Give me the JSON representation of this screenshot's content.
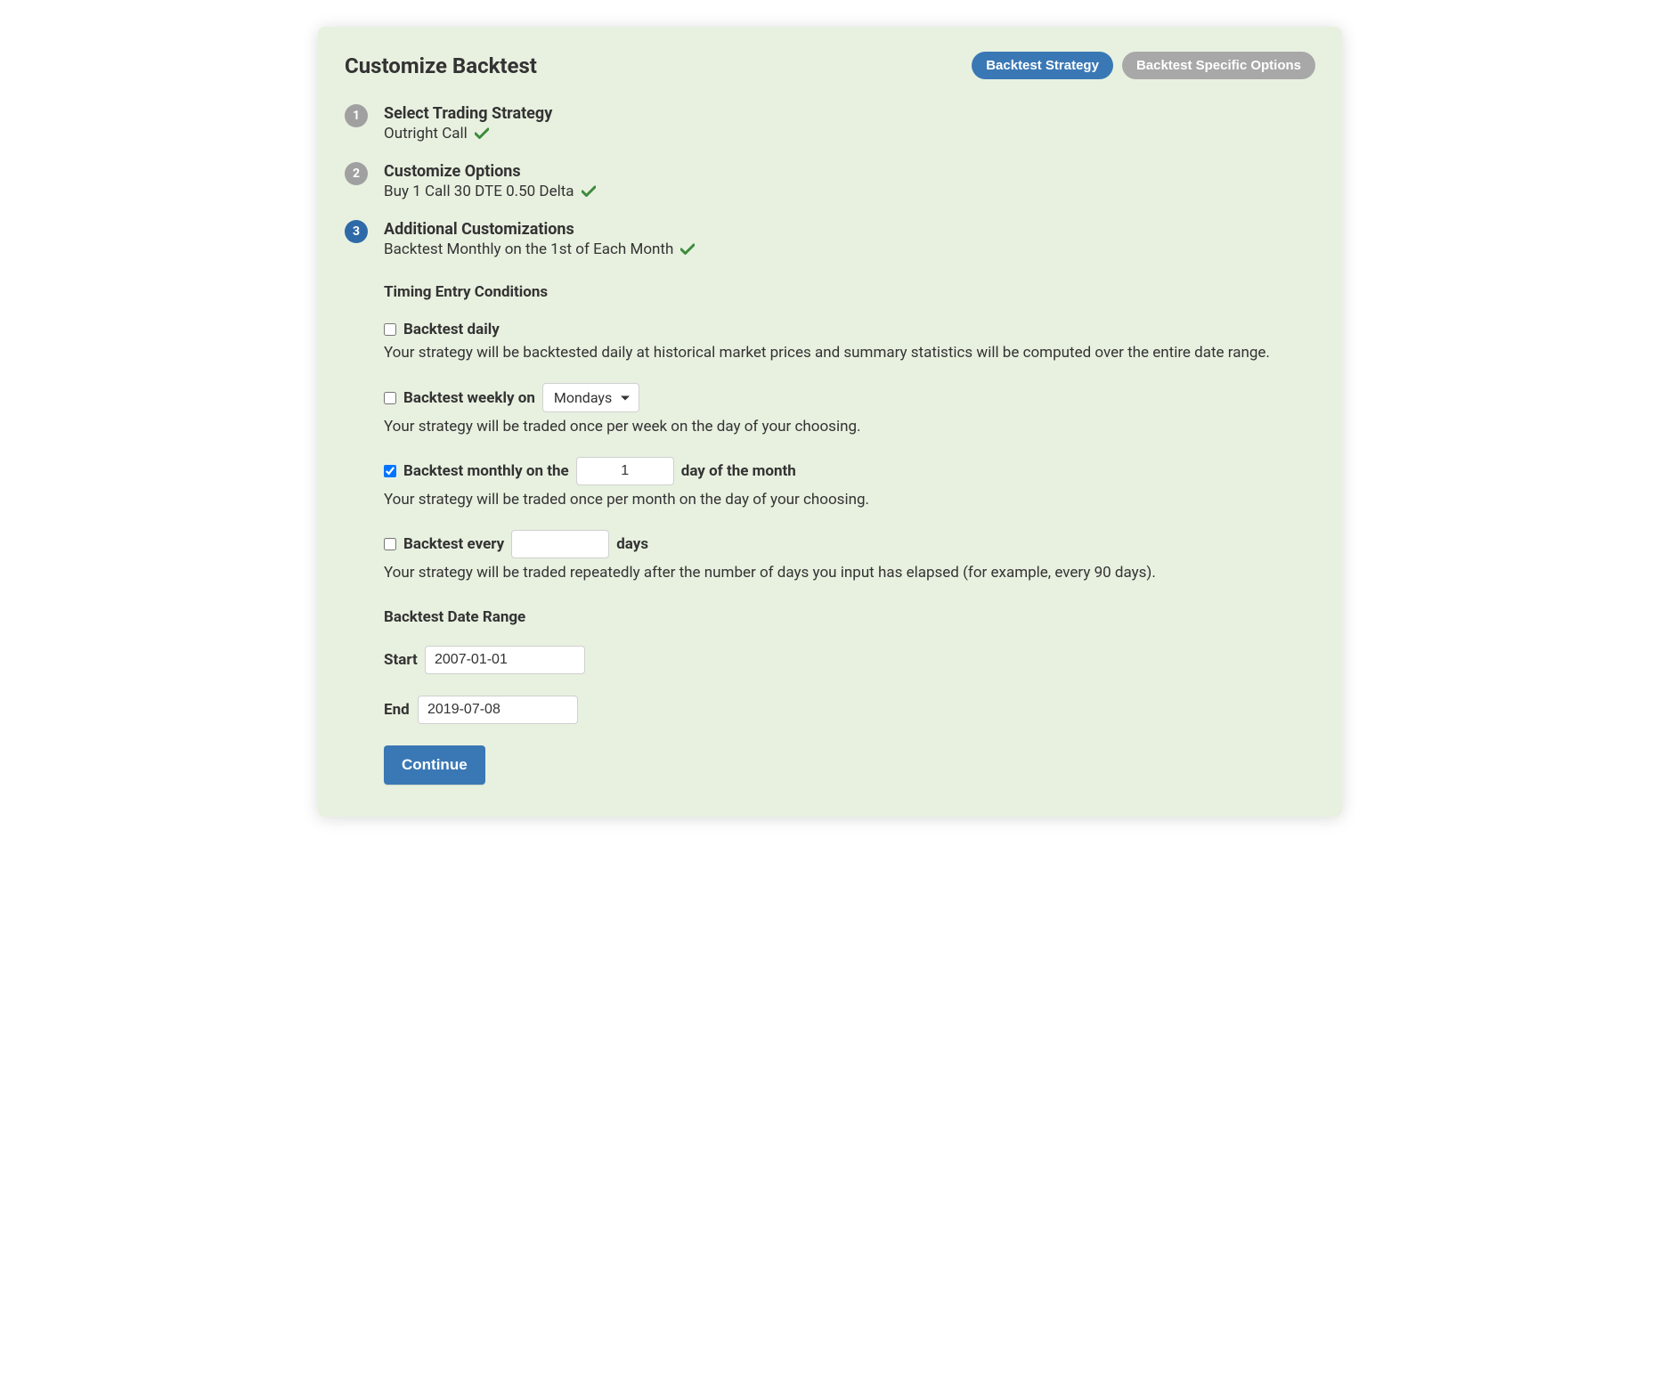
{
  "card": {
    "title": "Customize Backtest",
    "pills": {
      "primary": "Backtest Strategy",
      "secondary": "Backtest Specific Options"
    }
  },
  "steps": [
    {
      "num": "1",
      "title": "Select Trading Strategy",
      "sub": "Outright Call"
    },
    {
      "num": "2",
      "title": "Customize Options",
      "sub": "Buy 1 Call 30 DTE 0.50 Delta"
    },
    {
      "num": "3",
      "title": "Additional Customizations",
      "sub": "Backtest Monthly on the 1st of Each Month"
    }
  ],
  "timing": {
    "title": "Timing Entry Conditions",
    "daily": {
      "label": "Backtest daily",
      "desc": "Your strategy will be backtested daily at historical market prices and summary statistics will be computed over the entire date range."
    },
    "weekly": {
      "label_before": "Backtest weekly on",
      "selected": "Mondays",
      "desc": "Your strategy will be traded once per week on the day of your choosing."
    },
    "monthly": {
      "label_before": "Backtest monthly on the",
      "value": "1",
      "label_after": "day of the month",
      "desc": "Your strategy will be traded once per month on the day of your choosing."
    },
    "every": {
      "label_before": "Backtest every",
      "value": "",
      "label_after": "days",
      "desc": "Your strategy will be traded repeatedly after the number of days you input has elapsed (for example, every 90 days)."
    }
  },
  "date_range": {
    "title": "Backtest Date Range",
    "start_label": "Start",
    "start_value": "2007-01-01",
    "end_label": "End",
    "end_value": "2019-07-08"
  },
  "continue_label": "Continue"
}
